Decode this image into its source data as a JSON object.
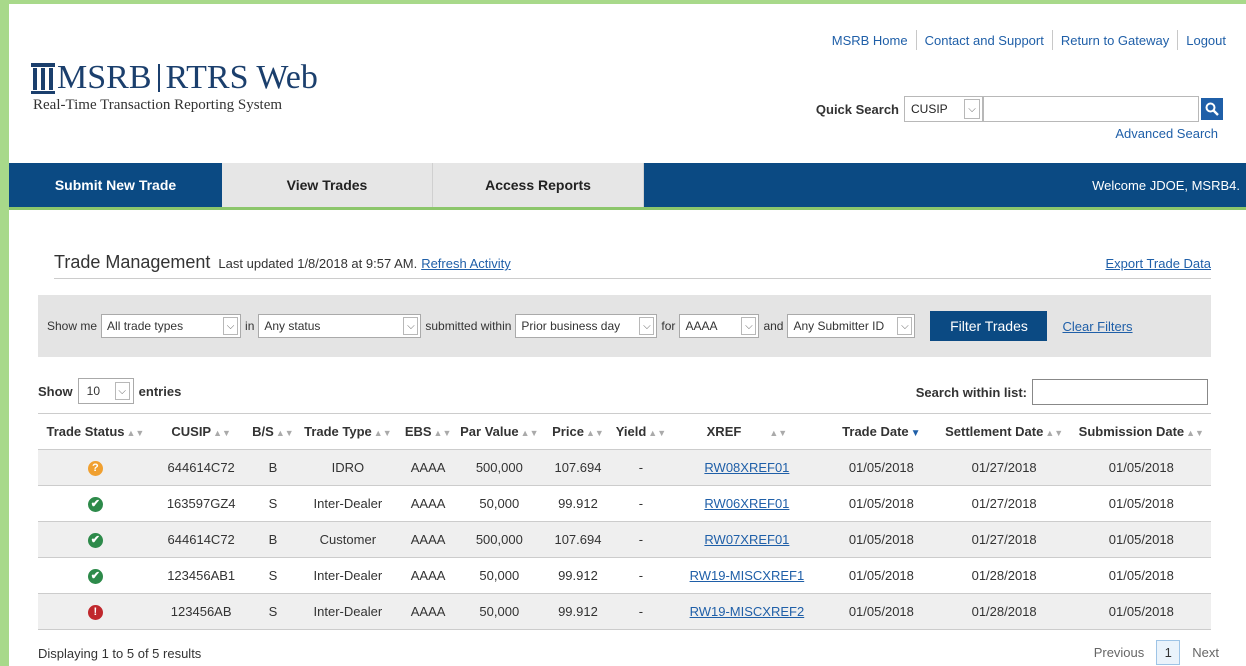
{
  "top_links": [
    "MSRB Home",
    "Contact and Support",
    "Return to Gateway",
    "Logout"
  ],
  "logo": {
    "title_left": "MSRB",
    "title_right": "RTRS Web",
    "subtitle": "Real-Time Transaction Reporting System"
  },
  "quick_search": {
    "label": "Quick Search",
    "type_value": "CUSIP",
    "query": "",
    "advanced_link": "Advanced Search"
  },
  "nav": {
    "tabs": [
      "Submit New Trade",
      "View Trades",
      "Access Reports"
    ],
    "welcome": "Welcome JDOE, MSRB4."
  },
  "trade_management": {
    "title": "Trade Management",
    "last_updated": "Last updated 1/8/2018 at 9:57 AM.",
    "refresh_link": "Refresh Activity",
    "export_link": "Export Trade Data"
  },
  "filters": {
    "show_me_label": "Show me",
    "trade_types": "All trade types",
    "in_label": "in",
    "status": "Any status",
    "submitted_within_label": "submitted within",
    "period": "Prior business day",
    "for_label": "for",
    "dealer": "AAAA",
    "and_label": "and",
    "submitter": "Any Submitter ID",
    "filter_button": "Filter Trades",
    "clear_link": "Clear Filters"
  },
  "list_controls": {
    "show_label": "Show",
    "entries_value": "10",
    "entries_label": "entries",
    "search_label": "Search within list:",
    "search_value": ""
  },
  "table": {
    "columns": [
      "Trade Status",
      "CUSIP",
      "B/S",
      "Trade Type",
      "EBS",
      "Par Value",
      "Price",
      "Yield",
      "XREF",
      "Trade Date",
      "Settlement Date",
      "Submission Date"
    ],
    "rows": [
      {
        "status": "pending",
        "status_glyph": "?",
        "cusip": "644614C72",
        "bs": "B",
        "trade_type": "IDRO",
        "ebs": "AAAA",
        "par_value": "500,000",
        "price": "107.694",
        "yield": "-",
        "xref": "RW08XREF01",
        "trade_date": "01/05/2018",
        "settlement_date": "01/27/2018",
        "submission_date": "01/05/2018"
      },
      {
        "status": "accepted",
        "status_glyph": "✔",
        "cusip": "163597GZ4",
        "bs": "S",
        "trade_type": "Inter-Dealer",
        "ebs": "AAAA",
        "par_value": "50,000",
        "price": "99.912",
        "yield": "-",
        "xref": "RW06XREF01",
        "trade_date": "01/05/2018",
        "settlement_date": "01/27/2018",
        "submission_date": "01/05/2018"
      },
      {
        "status": "accepted",
        "status_glyph": "✔",
        "cusip": "644614C72",
        "bs": "B",
        "trade_type": "Customer",
        "ebs": "AAAA",
        "par_value": "500,000",
        "price": "107.694",
        "yield": "-",
        "xref": "RW07XREF01",
        "trade_date": "01/05/2018",
        "settlement_date": "01/27/2018",
        "submission_date": "01/05/2018"
      },
      {
        "status": "accepted",
        "status_glyph": "✔",
        "cusip": "123456AB1",
        "bs": "S",
        "trade_type": "Inter-Dealer",
        "ebs": "AAAA",
        "par_value": "50,000",
        "price": "99.912",
        "yield": "-",
        "xref": "RW19-MISCXREF1",
        "trade_date": "01/05/2018",
        "settlement_date": "01/28/2018",
        "submission_date": "01/05/2018"
      },
      {
        "status": "error",
        "status_glyph": "!",
        "cusip": "123456AB",
        "bs": "S",
        "trade_type": "Inter-Dealer",
        "ebs": "AAAA",
        "par_value": "50,000",
        "price": "99.912",
        "yield": "-",
        "xref": "RW19-MISCXREF2",
        "trade_date": "01/05/2018",
        "settlement_date": "01/28/2018",
        "submission_date": "01/05/2018"
      }
    ]
  },
  "footer": {
    "count_text": "Displaying 1 to 5 of 5 results",
    "previous": "Previous",
    "page": "1",
    "next": "Next"
  },
  "colors": {
    "brand_navy": "#0b4a83",
    "link_blue": "#1f5fa8",
    "frame_green": "#a8d98a",
    "status_pending": "#f0a030",
    "status_accepted": "#2d8a4a",
    "status_error": "#c0282d"
  }
}
